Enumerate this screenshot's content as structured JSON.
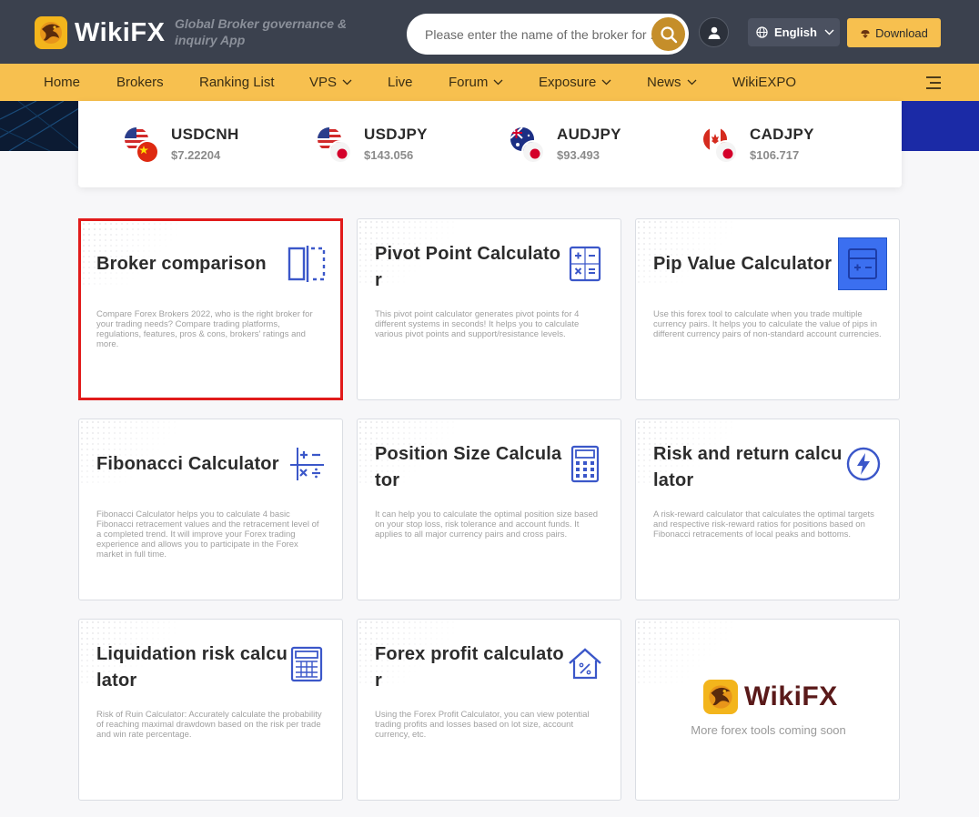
{
  "header": {
    "logo_text": "WikiFX",
    "tagline": "Global Broker governance & inquiry App",
    "search_placeholder": "Please enter the name of the broker for ...",
    "language": "English",
    "download": "Download"
  },
  "nav": {
    "home": "Home",
    "brokers": "Brokers",
    "ranking": "Ranking List",
    "vps": "VPS",
    "live": "Live",
    "forum": "Forum",
    "exposure": "Exposure",
    "news": "News",
    "wikiexpo": "WikiEXPO"
  },
  "ticker": [
    {
      "symbol": "USDCNH",
      "price": "$7.22204",
      "flags": [
        "us-flag",
        "cn-flag"
      ]
    },
    {
      "symbol": "USDJPY",
      "price": "$143.056",
      "flags": [
        "us-flag",
        "jp-flag"
      ]
    },
    {
      "symbol": "AUDJPY",
      "price": "$93.493",
      "flags": [
        "au-flag",
        "jp-flag"
      ]
    },
    {
      "symbol": "CADJPY",
      "price": "$106.717",
      "flags": [
        "ca-flag",
        "jp-flag"
      ]
    }
  ],
  "tools": [
    {
      "title": "Broker comparison",
      "desc": "Compare Forex Brokers 2022, who is the right broker for your trading needs? Compare trading platforms, regulations, features, pros & cons, brokers' ratings and more.",
      "icon": "compare-icon"
    },
    {
      "title": "Pivot Point Calculator",
      "desc": "This pivot point calculator generates pivot points for 4 different systems in seconds! It helps you to calculate various pivot points and support/resistance levels.",
      "icon": "calculator-icon"
    },
    {
      "title": "Pip Value Calculator",
      "desc": "Use this forex tool to calculate when you trade multiple currency pairs. It helps you to calculate the value of pips in different currency pairs of non-standard account currencies.",
      "icon": "pip-calculator-icon"
    },
    {
      "title": "Fibonacci Calculator",
      "desc": "Fibonacci Calculator helps you to calculate 4 basic Fibonacci retracement values and the retracement level of a completed trend. It will improve your Forex trading experience and allows you to participate in the Forex market in full time.",
      "icon": "math-symbols-icon"
    },
    {
      "title": "Position Size Calculator",
      "desc": "It can help you to calculate the optimal position size based on your stop loss, risk tolerance and account funds. It applies to all major currency pairs and cross pairs.",
      "icon": "keypad-calculator-icon"
    },
    {
      "title": "Risk and return calculator",
      "desc": "A risk-reward calculator that calculates the optimal targets and respective risk-reward ratios for positions based on Fibonacci retracements of local peaks and bottoms.",
      "icon": "lightning-icon"
    },
    {
      "title": "Liquidation risk calculator",
      "desc": "Risk of Ruin Calculator: Accurately calculate the probability of reaching maximal drawdown based on the risk per trade and win rate percentage.",
      "icon": "grid-calculator-icon"
    },
    {
      "title": "Forex profit calculator",
      "desc": "Using the Forex Profit Calculator, you can view potential trading profits and losses based on lot size, account currency, etc.",
      "icon": "house-percent-icon"
    }
  ],
  "coming_soon": {
    "logo_text": "WikiFX",
    "subtitle": "More forex tools coming soon"
  },
  "colors": {
    "topbar": "#3b414e",
    "accent": "#f7c04f",
    "icon_blue": "#3b57c9",
    "selected_border": "#e11b1b"
  }
}
